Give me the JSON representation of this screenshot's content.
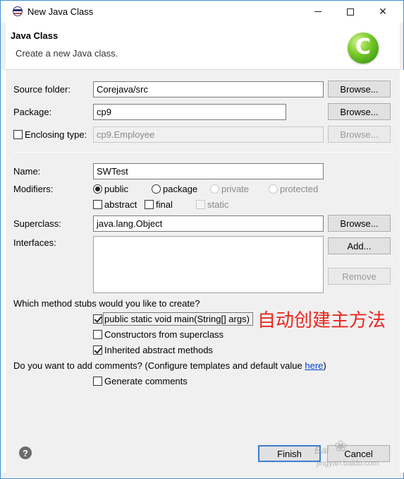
{
  "window": {
    "title": "New Java Class"
  },
  "banner": {
    "title": "Java Class",
    "description": "Create a new Java class.",
    "icon": "java-class-c-icon"
  },
  "form": {
    "source_folder": {
      "label": "Source folder:",
      "value": "Corejava/src",
      "button": "Browse..."
    },
    "package": {
      "label": "Package:",
      "value": "cp9",
      "button": "Browse..."
    },
    "enclosing_type": {
      "label": "Enclosing type:",
      "value": "cp9.Employee",
      "button": "Browse...",
      "checked": false
    },
    "name": {
      "label": "Name:",
      "value": "SWTest"
    },
    "modifiers": {
      "label": "Modifiers:",
      "public": "public",
      "package": "package",
      "private": "private",
      "protected": "protected",
      "abstract": "abstract",
      "final": "final",
      "static": "static",
      "selected": "public"
    },
    "superclass": {
      "label": "Superclass:",
      "value": "java.lang.Object",
      "button": "Browse..."
    },
    "interfaces": {
      "label": "Interfaces:",
      "add_button": "Add...",
      "remove_button": "Remove"
    },
    "stubs": {
      "question": "Which method stubs would you like to create?",
      "main": {
        "label": "public static void main(String[] args)",
        "checked": true
      },
      "constructors": {
        "label": "Constructors from superclass",
        "checked": false
      },
      "inherited": {
        "label": "Inherited abstract methods",
        "checked": true
      }
    },
    "comments": {
      "question": "Do you want to add comments? (Configure templates and default value ",
      "link": "here",
      "close_paren": ")",
      "generate": {
        "label": "Generate comments",
        "checked": false
      }
    }
  },
  "footer": {
    "finish": "Finish",
    "cancel": "Cancel"
  },
  "annotation": {
    "text": "自动创建主方法",
    "color": "#e8271f"
  },
  "watermark": {
    "text": "jingyan.baidu.com",
    "brand": "Bai"
  },
  "colors": {
    "accent": "#3c7fd1",
    "window_border": "#3c8fd6",
    "link": "#0044cc"
  }
}
